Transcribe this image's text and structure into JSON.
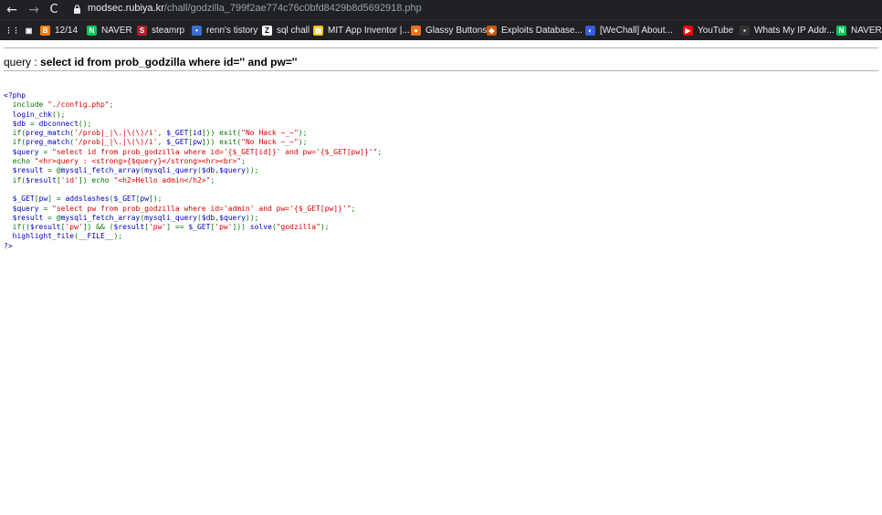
{
  "browser": {
    "url_host": "modsec.rubiya.kr",
    "url_path": "/chall/godzilla_799f2ae774c76c0bfd8429b8d5692918.php",
    "nav_back": "←",
    "nav_forward": "→",
    "nav_reload": "C"
  },
  "bookmarks": [
    {
      "label": "",
      "icon": "apps-grid-icon",
      "color": "#202124",
      "glyph": "⋮⋮"
    },
    {
      "label": "",
      "icon": "doc-icon",
      "color": "#202124",
      "glyph": "▣"
    },
    {
      "label": "12/14",
      "icon": "blogger-icon",
      "color": "#f57d00",
      "glyph": "B"
    },
    {
      "label": "NAVER",
      "icon": "naver-icon",
      "color": "#03c75a",
      "glyph": "N"
    },
    {
      "label": "steamrp",
      "icon": "steamrp-icon",
      "color": "#b0202a",
      "glyph": "S"
    },
    {
      "label": "renn's tistory",
      "icon": "tistory-icon",
      "color": "#3b6fd1",
      "glyph": "•"
    },
    {
      "label": "sql chall",
      "icon": "z-icon",
      "color": "#ffffff",
      "glyph": "Z"
    },
    {
      "label": "MIT App Inventor |...",
      "icon": "mit-icon",
      "color": "#ffc107",
      "glyph": "▦"
    },
    {
      "label": "Glassy Buttons",
      "icon": "glassy-icon",
      "color": "#e8711a",
      "glyph": "●"
    },
    {
      "label": "Exploits Database...",
      "icon": "exploitdb-icon",
      "color": "#d35400",
      "glyph": "◆"
    },
    {
      "label": "[WeChall] About...",
      "icon": "wechall-icon",
      "color": "#3a5bd9",
      "glyph": "◐"
    },
    {
      "label": "YouTube",
      "icon": "youtube-icon",
      "color": "#ff0000",
      "glyph": "▶"
    },
    {
      "label": "Whats My IP Addr...",
      "icon": "ip-icon",
      "color": "#333333",
      "glyph": "▪"
    },
    {
      "label": "NAVER",
      "icon": "naver-icon",
      "color": "#03c75a",
      "glyph": "N"
    }
  ],
  "query": {
    "label": "query : ",
    "sql": "select id from prob_godzilla where id='' and pw=''"
  },
  "source_lines": [
    [
      {
        "t": "p",
        "v": "<?php"
      }
    ],
    [
      {
        "t": "o",
        "v": "  "
      },
      {
        "t": "k",
        "v": "include "
      },
      {
        "t": "s",
        "v": "\"./config.php\""
      },
      {
        "t": "o",
        "v": ";"
      }
    ],
    [
      {
        "t": "o",
        "v": "  "
      },
      {
        "t": "p",
        "v": "login_chk"
      },
      {
        "t": "o",
        "v": "();"
      }
    ],
    [
      {
        "t": "o",
        "v": "  "
      },
      {
        "t": "p",
        "v": "$db "
      },
      {
        "t": "o",
        "v": "= "
      },
      {
        "t": "p",
        "v": "dbconnect"
      },
      {
        "t": "o",
        "v": "();"
      }
    ],
    [
      {
        "t": "o",
        "v": "  if("
      },
      {
        "t": "p",
        "v": "preg_match"
      },
      {
        "t": "o",
        "v": "("
      },
      {
        "t": "s",
        "v": "'/prob|_|\\.|\\(\\)/i'"
      },
      {
        "t": "o",
        "v": ", "
      },
      {
        "t": "p",
        "v": "$_GET"
      },
      {
        "t": "o",
        "v": "["
      },
      {
        "t": "p",
        "v": "id"
      },
      {
        "t": "o",
        "v": "])) exit("
      },
      {
        "t": "s",
        "v": "\"No Hack ~_~\""
      },
      {
        "t": "o",
        "v": ");"
      }
    ],
    [
      {
        "t": "o",
        "v": "  if("
      },
      {
        "t": "p",
        "v": "preg_match"
      },
      {
        "t": "o",
        "v": "("
      },
      {
        "t": "s",
        "v": "'/prob|_|\\.|\\(\\)/i'"
      },
      {
        "t": "o",
        "v": ", "
      },
      {
        "t": "p",
        "v": "$_GET"
      },
      {
        "t": "o",
        "v": "["
      },
      {
        "t": "p",
        "v": "pw"
      },
      {
        "t": "o",
        "v": "])) exit("
      },
      {
        "t": "s",
        "v": "\"No Hack ~_~\""
      },
      {
        "t": "o",
        "v": ");"
      }
    ],
    [
      {
        "t": "o",
        "v": "  "
      },
      {
        "t": "p",
        "v": "$query "
      },
      {
        "t": "o",
        "v": "= "
      },
      {
        "t": "s",
        "v": "\"select id from prob_godzilla where id='{$_GET[id]}' and pw='{$_GET[pw]}'\""
      },
      {
        "t": "o",
        "v": ";"
      }
    ],
    [
      {
        "t": "o",
        "v": "  "
      },
      {
        "t": "k",
        "v": "echo "
      },
      {
        "t": "s",
        "v": "\"<hr>query : <strong>{$query}</strong><hr><br>\""
      },
      {
        "t": "o",
        "v": ";"
      }
    ],
    [
      {
        "t": "o",
        "v": "  "
      },
      {
        "t": "p",
        "v": "$result "
      },
      {
        "t": "o",
        "v": "= @"
      },
      {
        "t": "p",
        "v": "mysqli_fetch_array"
      },
      {
        "t": "o",
        "v": "("
      },
      {
        "t": "p",
        "v": "mysqli_query"
      },
      {
        "t": "o",
        "v": "("
      },
      {
        "t": "p",
        "v": "$db"
      },
      {
        "t": "o",
        "v": ","
      },
      {
        "t": "p",
        "v": "$query"
      },
      {
        "t": "o",
        "v": "));"
      }
    ],
    [
      {
        "t": "o",
        "v": "  if("
      },
      {
        "t": "p",
        "v": "$result"
      },
      {
        "t": "o",
        "v": "["
      },
      {
        "t": "s",
        "v": "'id'"
      },
      {
        "t": "o",
        "v": "]) "
      },
      {
        "t": "k",
        "v": "echo "
      },
      {
        "t": "s",
        "v": "\"<h2>Hello admin</h2>\""
      },
      {
        "t": "o",
        "v": ";"
      }
    ],
    [
      {
        "t": "o",
        "v": ""
      }
    ],
    [
      {
        "t": "o",
        "v": "  "
      },
      {
        "t": "p",
        "v": "$_GET"
      },
      {
        "t": "o",
        "v": "["
      },
      {
        "t": "p",
        "v": "pw"
      },
      {
        "t": "o",
        "v": "] = "
      },
      {
        "t": "p",
        "v": "addslashes"
      },
      {
        "t": "o",
        "v": "("
      },
      {
        "t": "p",
        "v": "$_GET"
      },
      {
        "t": "o",
        "v": "["
      },
      {
        "t": "p",
        "v": "pw"
      },
      {
        "t": "o",
        "v": "]);"
      }
    ],
    [
      {
        "t": "o",
        "v": "  "
      },
      {
        "t": "p",
        "v": "$query "
      },
      {
        "t": "o",
        "v": "= "
      },
      {
        "t": "s",
        "v": "\"select pw from prob_godzilla where id='admin' and pw='{$_GET[pw]}'\""
      },
      {
        "t": "o",
        "v": ";"
      }
    ],
    [
      {
        "t": "o",
        "v": "  "
      },
      {
        "t": "p",
        "v": "$result "
      },
      {
        "t": "o",
        "v": "= @"
      },
      {
        "t": "p",
        "v": "mysqli_fetch_array"
      },
      {
        "t": "o",
        "v": "("
      },
      {
        "t": "p",
        "v": "mysqli_query"
      },
      {
        "t": "o",
        "v": "("
      },
      {
        "t": "p",
        "v": "$db"
      },
      {
        "t": "o",
        "v": ","
      },
      {
        "t": "p",
        "v": "$query"
      },
      {
        "t": "o",
        "v": "));"
      }
    ],
    [
      {
        "t": "o",
        "v": "  if(("
      },
      {
        "t": "p",
        "v": "$result"
      },
      {
        "t": "o",
        "v": "["
      },
      {
        "t": "s",
        "v": "'pw'"
      },
      {
        "t": "o",
        "v": "]) && ("
      },
      {
        "t": "p",
        "v": "$result"
      },
      {
        "t": "o",
        "v": "["
      },
      {
        "t": "s",
        "v": "'pw'"
      },
      {
        "t": "o",
        "v": "] == "
      },
      {
        "t": "p",
        "v": "$_GET"
      },
      {
        "t": "o",
        "v": "["
      },
      {
        "t": "s",
        "v": "'pw'"
      },
      {
        "t": "o",
        "v": "])) "
      },
      {
        "t": "p",
        "v": "solve"
      },
      {
        "t": "o",
        "v": "("
      },
      {
        "t": "s",
        "v": "\"godzilla\""
      },
      {
        "t": "o",
        "v": ");"
      }
    ],
    [
      {
        "t": "o",
        "v": "  "
      },
      {
        "t": "p",
        "v": "highlight_file"
      },
      {
        "t": "o",
        "v": "("
      },
      {
        "t": "p",
        "v": "__FILE__"
      },
      {
        "t": "o",
        "v": ");"
      }
    ],
    [
      {
        "t": "p",
        "v": "?>"
      }
    ]
  ]
}
